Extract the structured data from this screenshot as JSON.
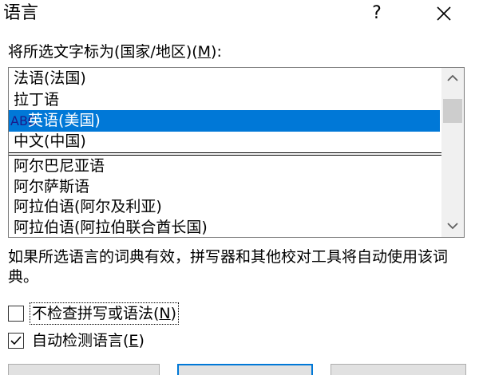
{
  "dialog": {
    "title": "语言",
    "help_label": "?"
  },
  "prompt": {
    "text": "将所选文字标为(国家/地区)(",
    "accel": "M",
    "suffix": "):"
  },
  "languages": [
    {
      "label": "法语(法国)",
      "selected": false
    },
    {
      "label": "拉丁语",
      "selected": false
    },
    {
      "label": "英语(美国)",
      "selected": true,
      "icon": "spell-check-icon"
    },
    {
      "label": "中文(中国)",
      "selected": false
    },
    {
      "label": "阿尔巴尼亚语",
      "selected": false
    },
    {
      "label": "阿尔萨斯语",
      "selected": false
    },
    {
      "label": "阿拉伯语(阿尔及利亚)",
      "selected": false
    },
    {
      "label": "阿拉伯语(阿拉伯联合酋长国)",
      "selected": false
    }
  ],
  "list_scroll_position": 0.1,
  "info": "如果所选语言的词典有效，拼写器和其他校对工具将自动使用该词典。",
  "options": {
    "no_proof": {
      "text": "不检查拼写或语法(",
      "accel": "N",
      "suffix": ")",
      "checked": false
    },
    "auto_detect": {
      "text": "自动检测语言(",
      "accel": "E",
      "suffix": ")",
      "checked": true
    }
  },
  "colors": {
    "selection": "#0078d7",
    "default_button_border": "#0078d7"
  }
}
